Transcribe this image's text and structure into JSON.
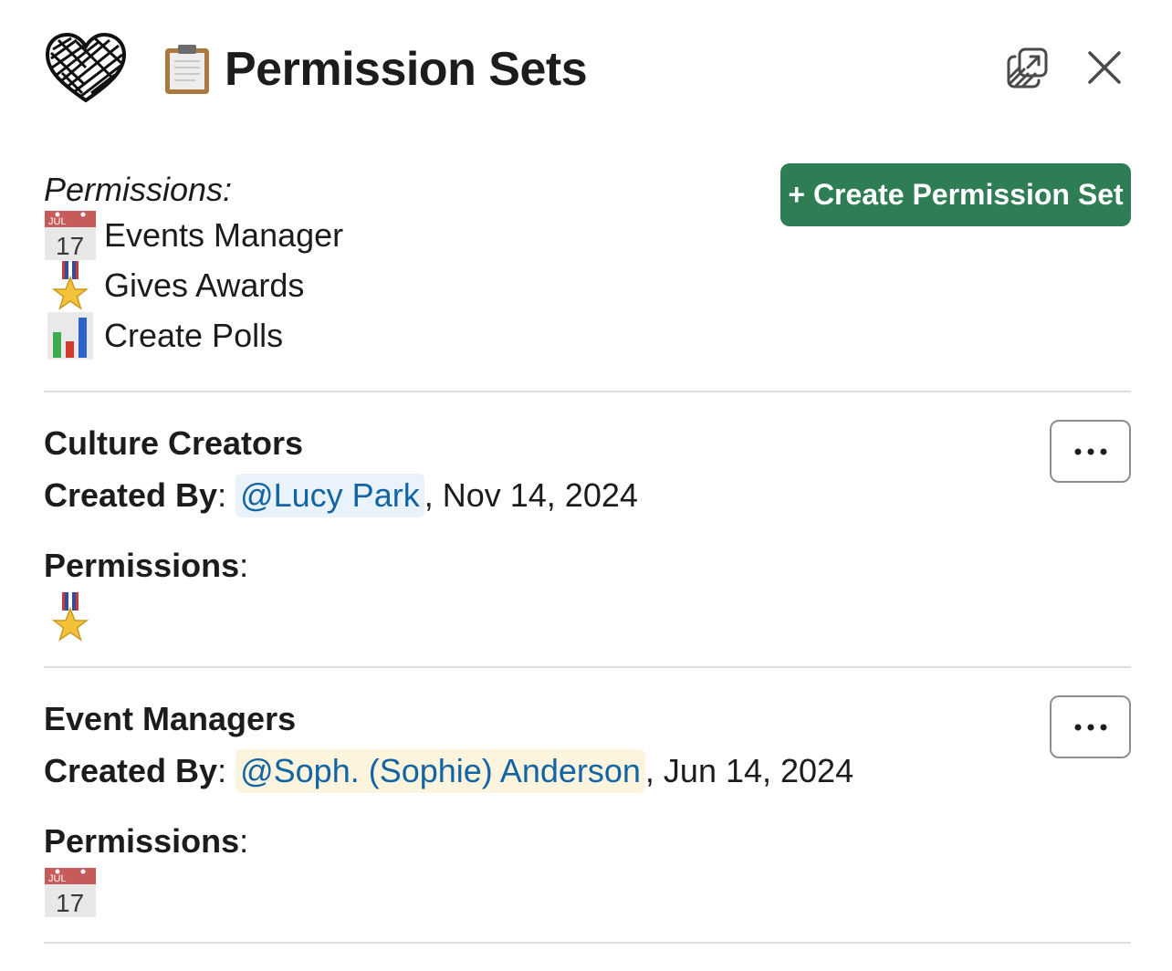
{
  "header": {
    "logo_icon": "rope-heart-logo",
    "title_icon": "clipboard-icon",
    "title": "Permission Sets",
    "popout_icon": "popout-window-icon",
    "close_icon": "close-icon"
  },
  "legend": {
    "heading": "Permissions:",
    "items": [
      {
        "icon": "calendar-icon",
        "label": "Events Manager"
      },
      {
        "icon": "military-medal-icon",
        "label": "Gives Awards"
      },
      {
        "icon": "bar-chart-icon",
        "label": "Create Polls"
      }
    ]
  },
  "create_button": {
    "label": "+ Create Permission Set",
    "color": "#2e7d55"
  },
  "calendar_icon_text": {
    "month": "JUL",
    "day": "17"
  },
  "sets": [
    {
      "name": "Culture Creators",
      "created_by_label": "Created By",
      "colon": ":",
      "creator": "@Lucy Park",
      "date": ", Nov 14, 2024",
      "permissions_label": "Permissions",
      "permissions": [
        "military-medal-icon"
      ],
      "more_icon": "ellipsis-icon"
    },
    {
      "name": "Event Managers",
      "created_by_label": "Created By",
      "colon": ":",
      "creator": "@Soph. (Sophie) Anderson",
      "date": ", Jun 14, 2024",
      "permissions_label": "Permissions",
      "permissions": [
        "calendar-icon"
      ],
      "more_icon": "ellipsis-icon"
    }
  ],
  "colors": {
    "mention_text": "#1264a3",
    "mention_bg_blue": "#eaf3fb",
    "mention_bg_yellow": "#fdf4de"
  }
}
